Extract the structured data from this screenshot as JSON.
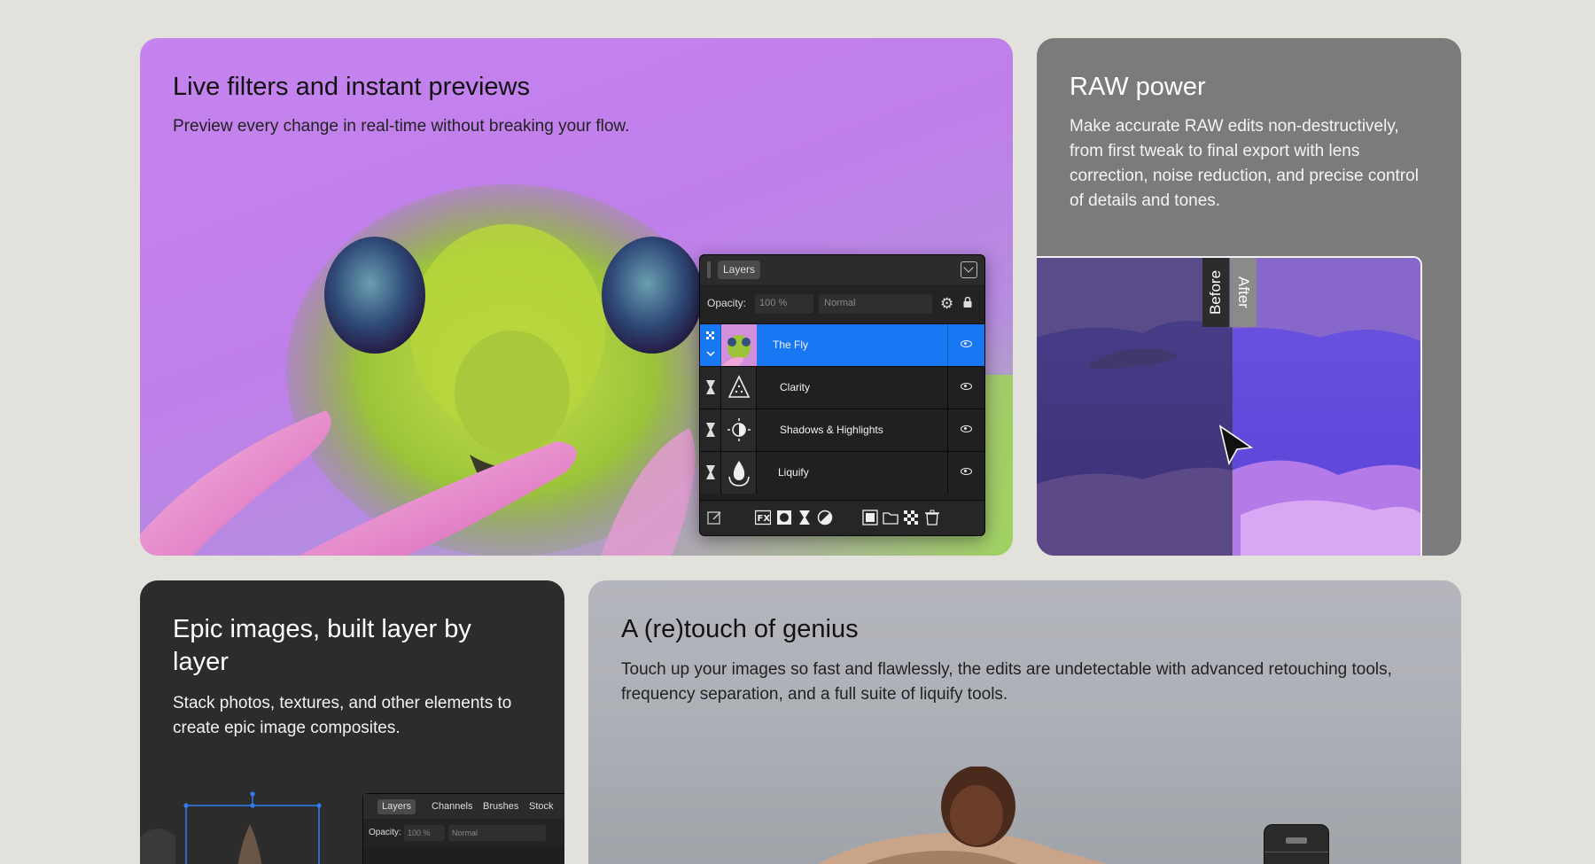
{
  "cards": {
    "filters": {
      "title": "Live filters and instant previews",
      "text": "Preview every change in real-time without breaking your flow.",
      "bg_color": "#c583ee"
    },
    "raw": {
      "title": "RAW power",
      "text": "Make accurate RAW edits non-destructively, from first tweak to final export with lens correction, noise reduction, and precise control of details and tones.",
      "before_label": "Before",
      "after_label": "After",
      "bg_color": "#7b7b7b"
    },
    "epic": {
      "title": "Epic images, built layer by layer",
      "text": "Stack photos, textures, and other elements to create epic image composites.",
      "bg_color": "#2b2c2b"
    },
    "retouch": {
      "title": "A (re)touch of genius",
      "text": "Touch up your images so fast and flawlessly, the edits are undetectable with advanced retouching tools, frequency separation, and a full suite of liquify tools.",
      "bg_color": "#b5b6bd"
    }
  },
  "layers_panel": {
    "tab": "Layers",
    "opacity_label": "Opacity:",
    "opacity_value": "100 %",
    "blend_mode": "Normal",
    "layers": [
      {
        "name": "The Fly",
        "selected": true,
        "icon": "fly-thumbnail"
      },
      {
        "name": "Clarity",
        "selected": false,
        "icon": "clarity-icon"
      },
      {
        "name": "Shadows & Highlights",
        "selected": false,
        "icon": "shadows-highlights-icon"
      },
      {
        "name": "Liquify",
        "selected": false,
        "icon": "liquify-icon"
      }
    ],
    "selection_color": "#1877f2"
  },
  "mini_panel": {
    "tabs": [
      "Layers",
      "Channels",
      "Brushes",
      "Stock"
    ],
    "opacity_label": "Opacity:",
    "opacity_value": "100 %",
    "blend_mode": "Normal"
  }
}
